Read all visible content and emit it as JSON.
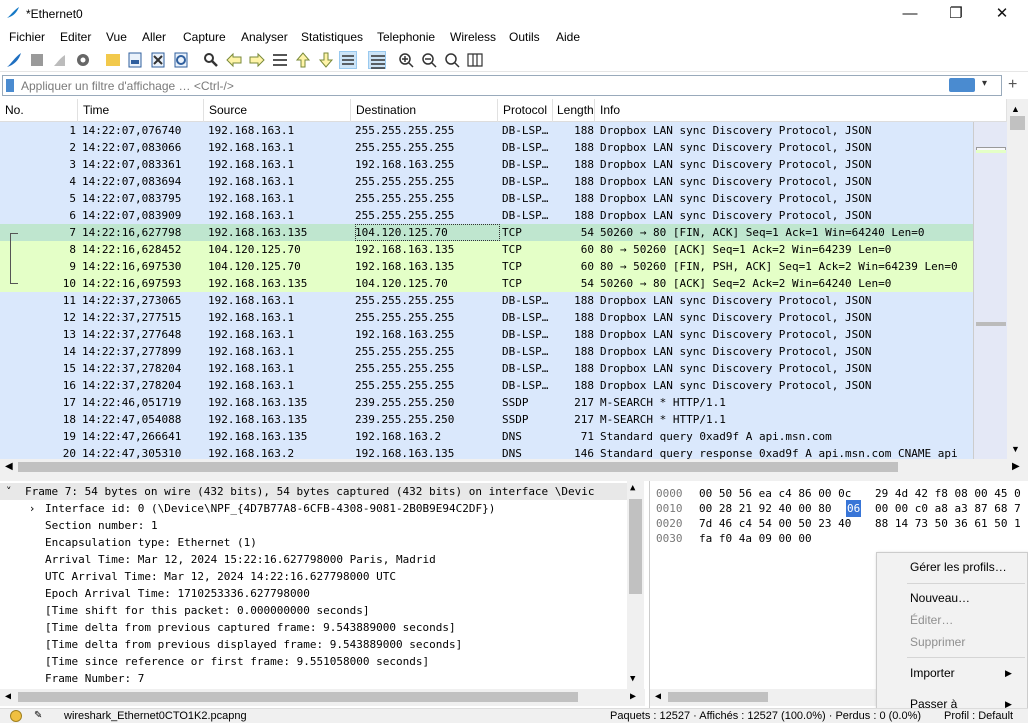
{
  "window": {
    "title": "*Ethernet0",
    "minimize": "—",
    "maximize": "❐",
    "close": "✕"
  },
  "menu": [
    "Fichier",
    "Editer",
    "Vue",
    "Aller",
    "Capture",
    "Analyser",
    "Statistiques",
    "Telephonie",
    "Wireless",
    "Outils",
    "Aide"
  ],
  "toolbar": {
    "icons": [
      "shark-fin-start-icon",
      "stop-icon",
      "restart-icon",
      "options-gear-icon",
      "open-folder-icon",
      "save-file-icon",
      "close-file-icon",
      "reload-icon",
      "find-icon",
      "back-arrow-icon",
      "forward-arrow-icon",
      "goto-packet-icon",
      "first-packet-icon",
      "last-packet-icon",
      "autoscroll-icon",
      "colorize-icon",
      "zoom-in-icon",
      "zoom-out-icon",
      "zoom-normal-icon",
      "resize-columns-icon"
    ]
  },
  "filter": {
    "placeholder": "Appliquer un filtre d'affichage … <Ctrl-/>",
    "plus": "+"
  },
  "columns": [
    "No.",
    "Time",
    "Source",
    "Destination",
    "Protocol",
    "Length",
    "Info"
  ],
  "colors": {
    "blue_row": "#dae8fc",
    "green_row": "#e4ffc7",
    "selected_row": "#bfe6cf"
  },
  "packets": [
    {
      "no": "1",
      "time": "14:22:07,076740",
      "src": "192.168.163.1",
      "dst": "255.255.255.255",
      "proto": "DB-LSP…",
      "len": "188",
      "info": "Dropbox LAN sync Discovery Protocol, JSON",
      "color": "blue"
    },
    {
      "no": "2",
      "time": "14:22:07,083066",
      "src": "192.168.163.1",
      "dst": "255.255.255.255",
      "proto": "DB-LSP…",
      "len": "188",
      "info": "Dropbox LAN sync Discovery Protocol, JSON",
      "color": "blue"
    },
    {
      "no": "3",
      "time": "14:22:07,083361",
      "src": "192.168.163.1",
      "dst": "192.168.163.255",
      "proto": "DB-LSP…",
      "len": "188",
      "info": "Dropbox LAN sync Discovery Protocol, JSON",
      "color": "blue"
    },
    {
      "no": "4",
      "time": "14:22:07,083694",
      "src": "192.168.163.1",
      "dst": "255.255.255.255",
      "proto": "DB-LSP…",
      "len": "188",
      "info": "Dropbox LAN sync Discovery Protocol, JSON",
      "color": "blue"
    },
    {
      "no": "5",
      "time": "14:22:07,083795",
      "src": "192.168.163.1",
      "dst": "255.255.255.255",
      "proto": "DB-LSP…",
      "len": "188",
      "info": "Dropbox LAN sync Discovery Protocol, JSON",
      "color": "blue"
    },
    {
      "no": "6",
      "time": "14:22:07,083909",
      "src": "192.168.163.1",
      "dst": "255.255.255.255",
      "proto": "DB-LSP…",
      "len": "188",
      "info": "Dropbox LAN sync Discovery Protocol, JSON",
      "color": "blue"
    },
    {
      "no": "7",
      "time": "14:22:16,627798",
      "src": "192.168.163.135",
      "dst": "104.120.125.70",
      "proto": "TCP",
      "len": "54",
      "info": "50260 → 80 [FIN, ACK] Seq=1 Ack=1 Win=64240 Len=0",
      "color": "selected"
    },
    {
      "no": "8",
      "time": "14:22:16,628452",
      "src": "104.120.125.70",
      "dst": "192.168.163.135",
      "proto": "TCP",
      "len": "60",
      "info": "80 → 50260 [ACK] Seq=1 Ack=2 Win=64239 Len=0",
      "color": "green"
    },
    {
      "no": "9",
      "time": "14:22:16,697530",
      "src": "104.120.125.70",
      "dst": "192.168.163.135",
      "proto": "TCP",
      "len": "60",
      "info": "80 → 50260 [FIN, PSH, ACK] Seq=1 Ack=2 Win=64239 Len=0",
      "color": "green"
    },
    {
      "no": "10",
      "time": "14:22:16,697593",
      "src": "192.168.163.135",
      "dst": "104.120.125.70",
      "proto": "TCP",
      "len": "54",
      "info": "50260 → 80 [ACK] Seq=2 Ack=2 Win=64240 Len=0",
      "color": "green"
    },
    {
      "no": "11",
      "time": "14:22:37,273065",
      "src": "192.168.163.1",
      "dst": "255.255.255.255",
      "proto": "DB-LSP…",
      "len": "188",
      "info": "Dropbox LAN sync Discovery Protocol, JSON",
      "color": "blue"
    },
    {
      "no": "12",
      "time": "14:22:37,277515",
      "src": "192.168.163.1",
      "dst": "255.255.255.255",
      "proto": "DB-LSP…",
      "len": "188",
      "info": "Dropbox LAN sync Discovery Protocol, JSON",
      "color": "blue"
    },
    {
      "no": "13",
      "time": "14:22:37,277648",
      "src": "192.168.163.1",
      "dst": "192.168.163.255",
      "proto": "DB-LSP…",
      "len": "188",
      "info": "Dropbox LAN sync Discovery Protocol, JSON",
      "color": "blue"
    },
    {
      "no": "14",
      "time": "14:22:37,277899",
      "src": "192.168.163.1",
      "dst": "255.255.255.255",
      "proto": "DB-LSP…",
      "len": "188",
      "info": "Dropbox LAN sync Discovery Protocol, JSON",
      "color": "blue"
    },
    {
      "no": "15",
      "time": "14:22:37,278204",
      "src": "192.168.163.1",
      "dst": "255.255.255.255",
      "proto": "DB-LSP…",
      "len": "188",
      "info": "Dropbox LAN sync Discovery Protocol, JSON",
      "color": "blue"
    },
    {
      "no": "16",
      "time": "14:22:37,278204",
      "src": "192.168.163.1",
      "dst": "255.255.255.255",
      "proto": "DB-LSP…",
      "len": "188",
      "info": "Dropbox LAN sync Discovery Protocol, JSON",
      "color": "blue"
    },
    {
      "no": "17",
      "time": "14:22:46,051719",
      "src": "192.168.163.135",
      "dst": "239.255.255.250",
      "proto": "SSDP",
      "len": "217",
      "info": "M-SEARCH * HTTP/1.1",
      "color": "blue"
    },
    {
      "no": "18",
      "time": "14:22:47,054088",
      "src": "192.168.163.135",
      "dst": "239.255.255.250",
      "proto": "SSDP",
      "len": "217",
      "info": "M-SEARCH * HTTP/1.1",
      "color": "blue"
    },
    {
      "no": "19",
      "time": "14:22:47,266641",
      "src": "192.168.163.135",
      "dst": "192.168.163.2",
      "proto": "DNS",
      "len": "71",
      "info": "Standard query 0xad9f A api.msn.com",
      "color": "blue"
    },
    {
      "no": "20",
      "time": "14:22:47,305310",
      "src": "192.168.163.2",
      "dst": "192.168.163.135",
      "proto": "DNS",
      "len": "146",
      "info": "Standard query response 0xad9f A api.msn.com CNAME api",
      "color": "blue"
    }
  ],
  "details": [
    {
      "indent": 0,
      "expander": "˅",
      "text": "Frame 7: 54 bytes on wire (432 bits), 54 bytes captured (432 bits) on interface \\Devic"
    },
    {
      "indent": 1,
      "expander": "›",
      "text": "Interface id: 0 (\\Device\\NPF_{4D7B77A8-6CFB-4308-9081-2B0B9E94C2DF})"
    },
    {
      "indent": 1,
      "expander": "",
      "text": "Section number: 1"
    },
    {
      "indent": 1,
      "expander": "",
      "text": "Encapsulation type: Ethernet (1)"
    },
    {
      "indent": 1,
      "expander": "",
      "text": "Arrival Time: Mar 12, 2024 15:22:16.627798000 Paris, Madrid"
    },
    {
      "indent": 1,
      "expander": "",
      "text": "UTC Arrival Time: Mar 12, 2024 14:22:16.627798000 UTC"
    },
    {
      "indent": 1,
      "expander": "",
      "text": "Epoch Arrival Time: 1710253336.627798000"
    },
    {
      "indent": 1,
      "expander": "",
      "text": "[Time shift for this packet: 0.000000000 seconds]"
    },
    {
      "indent": 1,
      "expander": "",
      "text": "[Time delta from previous captured frame: 9.543889000 seconds]"
    },
    {
      "indent": 1,
      "expander": "",
      "text": "[Time delta from previous displayed frame: 9.543889000 seconds]"
    },
    {
      "indent": 1,
      "expander": "",
      "text": "[Time since reference or first frame: 9.551058000 seconds]"
    },
    {
      "indent": 1,
      "expander": "",
      "text": "Frame Number: 7"
    }
  ],
  "bytes": [
    {
      "offset": "0000",
      "a": "00 50 56 ea c4 86 00 0c",
      "b": "29 4d 42 f8 08 00 45 0",
      "hl": ""
    },
    {
      "offset": "0010",
      "a": "00 28 21 92 40 00 80",
      "b": "00 00 c0 a8 a3 87 68 7",
      "hl": "06"
    },
    {
      "offset": "0020",
      "a": "7d 46 c4 54 00 50 23 40",
      "b": "88 14 73 50 36 61 50 1",
      "hl": ""
    },
    {
      "offset": "0030",
      "a": "fa f0 4a 09 00 00",
      "b": "",
      "hl": ""
    }
  ],
  "context_menu": [
    {
      "label": "Gérer les profils…",
      "disabled": false,
      "submenu": false
    },
    {
      "label": "Nouveau…",
      "disabled": false,
      "submenu": false
    },
    {
      "label": "Éditer…",
      "disabled": true,
      "submenu": false
    },
    {
      "label": "Supprimer",
      "disabled": true,
      "submenu": false
    },
    {
      "label": "Importer",
      "disabled": false,
      "submenu": true
    },
    {
      "label": "Passer à",
      "disabled": false,
      "submenu": true
    }
  ],
  "status": {
    "file": "wireshark_Ethernet0CTO1K2.pcapng",
    "stats": "Paquets : 12527 · Affichés : 12527 (100.0%) · Perdus : 0 (0.0%)",
    "profile": "Profil : Default"
  }
}
